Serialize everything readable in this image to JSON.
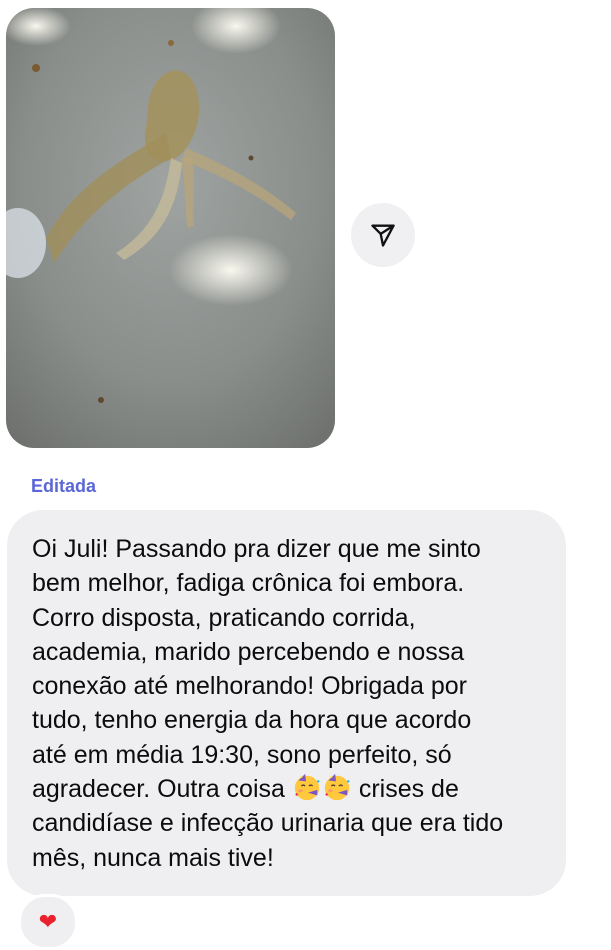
{
  "message": {
    "photo_icon": "attached-photo",
    "share_icon": "paper-plane-icon",
    "edited_label": "Editada",
    "text_before_emoji": "Oi Juli! Passando pra dizer que me sinto\nbem melhor, fadiga crônica foi embora.\nCorro disposta, praticando corrida,\nacademia, marido percebendo e nossa\nconexão até melhorando! Obrigada por\ntudo, tenho energia da hora que acordo\naté em média 19:30, sono perfeito, só\nagradecer. Outra coisa ",
    "emoji_name": "partying-face",
    "text_after_emoji": " crises de\ncandidíase e infecção urinaria que era tido\nmês, nunca mais tive!",
    "reaction": "❤"
  },
  "colors": {
    "edited_label": "#5b67d8",
    "bubble_bg": "#efeff2",
    "heart": "#e8212c"
  }
}
